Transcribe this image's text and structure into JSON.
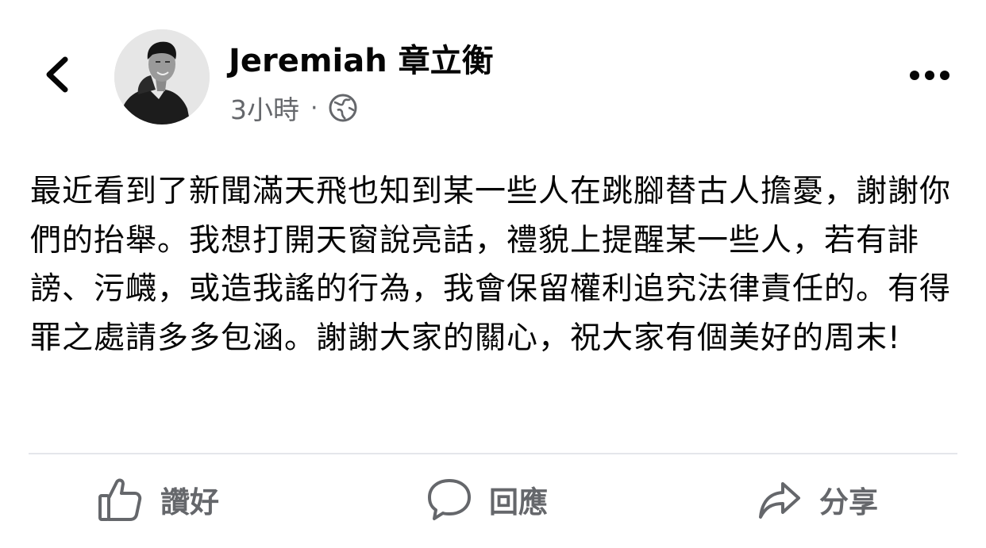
{
  "header": {
    "back_icon": "chevron-left-icon",
    "author_name": "Jeremiah 章立衡",
    "timestamp": "3小時",
    "separator": "·",
    "privacy_icon": "globe-icon",
    "more_icon": "more-dots-icon"
  },
  "post": {
    "text": "最近看到了新聞滿天飛也知到某一些人在跳腳替古人擔憂，謝謝你們的抬舉。我想打開天窗說亮話，禮貌上提醒某一些人，若有誹謗、污衊，或造我謠的行為，我會保留權利追究法律責任的。有得罪之處請多多包涵。謝謝大家的關心，祝大家有個美好的周末!"
  },
  "actions": {
    "like_label": "讚好",
    "comment_label": "回應",
    "share_label": "分享",
    "like_icon": "thumbs-up-icon",
    "comment_icon": "comment-bubble-icon",
    "share_icon": "share-arrow-icon"
  },
  "colors": {
    "text_primary": "#050505",
    "text_secondary": "#65676b",
    "divider": "#e4e6eb"
  }
}
